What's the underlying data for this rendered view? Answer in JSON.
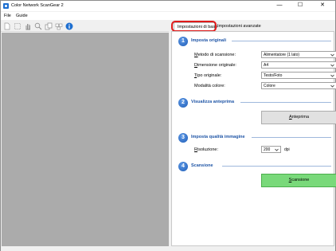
{
  "window": {
    "title": "Color Network ScanGear 2",
    "controls": {
      "minimize": "—",
      "maximize": "☐",
      "close": "✕"
    }
  },
  "menu": {
    "file": "File",
    "guide": "Guide"
  },
  "toolbar": {
    "buttons": [
      "new-page-icon",
      "select-icon",
      "hand-icon",
      "zoom-icon",
      "copy-icon",
      "multi-page-icon",
      "info-icon"
    ]
  },
  "tabs": {
    "basic": "Impostazioni di base",
    "advanced": "Impostazioni avanzate"
  },
  "sections": {
    "originals": {
      "number": "1",
      "title": "Imposta originali",
      "scan_method_label_u": "M",
      "scan_method_label": "etodo di scansione:",
      "scan_method_value": "Alimentatore (1 lato)",
      "size_label_u": "D",
      "size_label": "imensione originale:",
      "size_value": "A4",
      "type_label_u": "T",
      "type_label": "ipo originale:",
      "type_value": "Testo/Foto",
      "color_label": "Modalità colore:",
      "color_value": "Colore"
    },
    "preview": {
      "number": "2",
      "title": "Visualizza anteprima",
      "button_u": "A",
      "button": "nteprima"
    },
    "quality": {
      "number": "3",
      "title": "Imposta qualità immagine",
      "resolution_label_u": "R",
      "resolution_label": "isoluzione:",
      "resolution_value": "200",
      "resolution_unit": "dpi"
    },
    "scan": {
      "number": "4",
      "title": "Scansione",
      "button_u": "S",
      "button": "cansione"
    }
  },
  "colors": {
    "highlight": "#e01b1b",
    "section_title": "#1f55a6",
    "scan_button": "#79d97a",
    "preview_area": "#ababab"
  }
}
